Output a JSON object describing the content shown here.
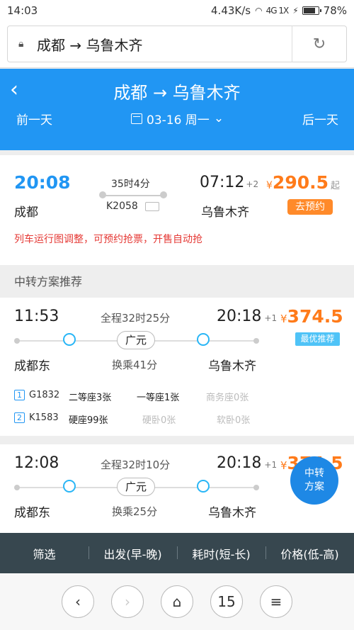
{
  "status_bar": {
    "time": "14:03",
    "speed": "4.43K/s",
    "network": "4G 1X",
    "battery": "78%",
    "battery_level": 0.78
  },
  "browser": {
    "url_text": "成都 → 乌鲁木齐"
  },
  "header": {
    "title": "成都 → 乌鲁木齐",
    "prev_day": "前一天",
    "date": "03-16 周一",
    "next_day": "后一天"
  },
  "direct_train": {
    "depart_time": "20:08",
    "depart_station": "成都",
    "duration": "35时4分",
    "train_no": "K2058",
    "arrive_time": "07:12",
    "arrive_offset": "+2",
    "arrive_station": "乌鲁木齐",
    "currency": "¥",
    "price": "290.5",
    "price_suffix": "起",
    "book_label": "去预约",
    "notice": "列车运行图调整，可预约抢票，开售自动抢"
  },
  "transfer_section_title": "中转方案推荐",
  "transfers": [
    {
      "depart_time": "11:53",
      "total": "全程32时25分",
      "arrive_time": "20:18",
      "arrive_offset": "+1",
      "currency": "¥",
      "price": "374.5",
      "tag": "最优推荐",
      "transfer_station": "广元",
      "from": "成都东",
      "wait": "换乘41分",
      "to": "乌鲁木齐",
      "segments": [
        {
          "index": "1",
          "train": "G1832",
          "seats": [
            "二等座3张",
            "一等座1张",
            "商务座0张"
          ]
        },
        {
          "index": "2",
          "train": "K1583",
          "seats": [
            "硬座99张",
            "硬卧0张",
            "软卧0张"
          ]
        }
      ]
    },
    {
      "depart_time": "12:08",
      "total": "全程32时10分",
      "arrive_time": "20:18",
      "arrive_offset": "+1",
      "currency": "¥",
      "price": "374.5",
      "transfer_station": "广元",
      "from": "成都东",
      "wait": "换乘25分",
      "to": "乌鲁木齐"
    }
  ],
  "fab": {
    "line1": "中转",
    "line2": "方案"
  },
  "filter_bar": {
    "filter": "筛选",
    "depart": "出发(早-晚)",
    "duration": "耗时(短-长)",
    "price": "价格(低-高)"
  },
  "bottom_nav": {
    "tab_count": "15"
  },
  "colors": {
    "primary": "#2196f3",
    "price": "#ff7b1a",
    "dark_bar": "#37474f"
  }
}
